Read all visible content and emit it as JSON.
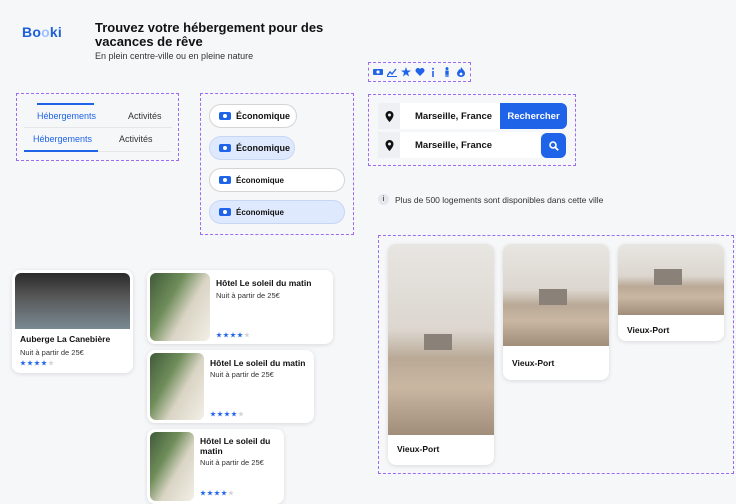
{
  "header": {
    "logo": "Booki",
    "title": "Trouvez votre hébergement pour des vacances de rêve",
    "subtitle": "En plein centre-ville ou en pleine nature"
  },
  "icons": [
    "money-icon",
    "chart-icon",
    "star-icon",
    "heart-icon",
    "info-icon",
    "person-icon",
    "fire-icon"
  ],
  "tabs": {
    "row1": [
      "Hébergements",
      "Activités"
    ],
    "row2": [
      "Hébergements",
      "Activités"
    ]
  },
  "filters": [
    "Économique",
    "Économique",
    "Économique",
    "Économique"
  ],
  "search": {
    "value1": "Marseille, France",
    "button": "Rechercher",
    "value2": "Marseille, France"
  },
  "info_text": "Plus de 500 logements sont disponibles dans cette ville",
  "hostel": {
    "name": "Auberge La Canebière",
    "price": "Nuit à partir de 25€",
    "stars": 4
  },
  "hotels": [
    {
      "name": "Hôtel Le soleil du matin",
      "price": "Nuit à partir de 25€",
      "stars": 4
    },
    {
      "name": "Hôtel Le soleil du matin",
      "price": "Nuit à partir de 25€",
      "stars": 4
    },
    {
      "name": "Hôtel Le soleil du matin",
      "price": "Nuit à partir de 25€",
      "stars": 4
    }
  ],
  "destinations": [
    "Vieux-Port",
    "Vieux-Port",
    "Vieux-Port"
  ],
  "colors": {
    "accent": "#1f63e8",
    "selected_pill": "#dfe9fd",
    "dashed_border": "#9b6cf2"
  }
}
